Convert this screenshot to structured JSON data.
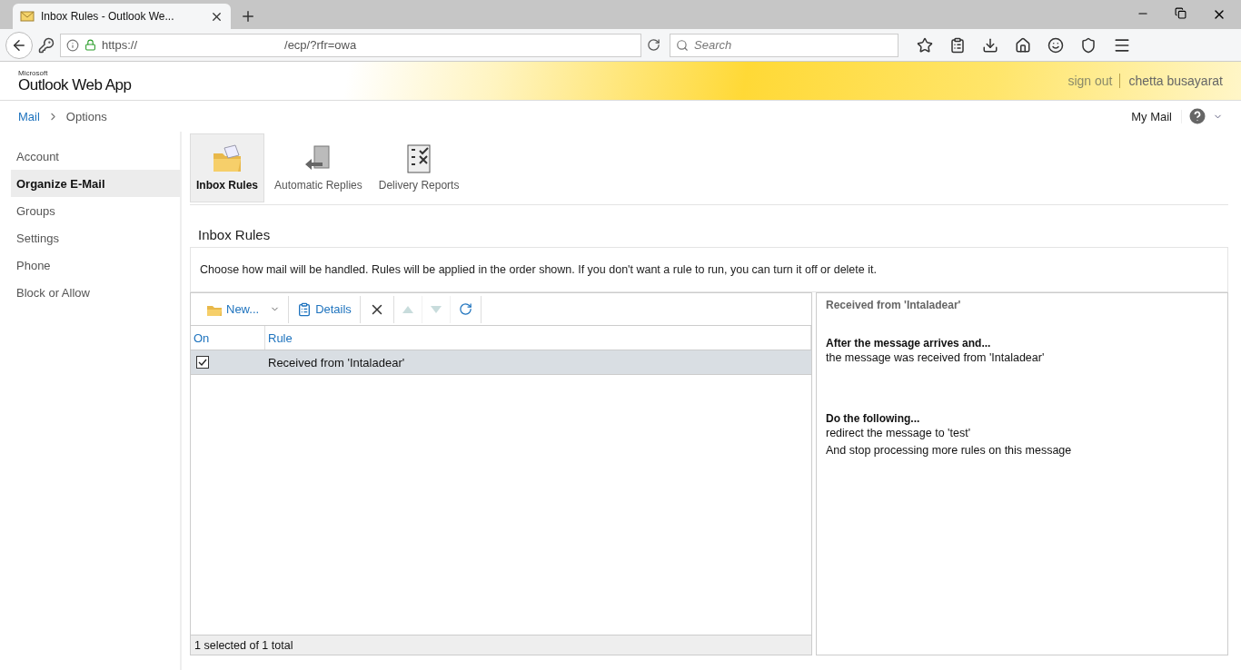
{
  "browser": {
    "tab_title": "Inbox Rules - Outlook We...",
    "url_start": "https://",
    "url_end": "/ecp/?rfr=owa",
    "search_placeholder": "Search"
  },
  "header": {
    "logo_small": "Microsoft",
    "logo": "Outlook Web App",
    "sign_out": "sign out",
    "user": "chetta busayarat"
  },
  "breadcrumb": [
    {
      "label": "Mail",
      "kind": "link"
    },
    {
      "label": "Options",
      "kind": "current"
    }
  ],
  "my_mail": "My Mail",
  "sidebar": {
    "items": [
      {
        "label": "Account",
        "selected": false
      },
      {
        "label": "Organize E-Mail",
        "selected": true
      },
      {
        "label": "Groups",
        "selected": false
      },
      {
        "label": "Settings",
        "selected": false
      },
      {
        "label": "Phone",
        "selected": false
      },
      {
        "label": "Block or Allow",
        "selected": false
      }
    ]
  },
  "tabs": [
    {
      "label": "Inbox Rules",
      "selected": true,
      "kind": "rules"
    },
    {
      "label": "Automatic Replies",
      "selected": false,
      "kind": "replies"
    },
    {
      "label": "Delivery Reports",
      "selected": false,
      "kind": "reports"
    }
  ],
  "section_title": "Inbox Rules",
  "description": "Choose how mail will be handled. Rules will be applied in the order shown. If you don't want a rule to run, you can turn it off or delete it.",
  "toolbar": [
    {
      "kind": "new",
      "label": "New...",
      "disabled": false
    },
    {
      "kind": "details",
      "label": "Details",
      "disabled": false
    },
    {
      "kind": "delete",
      "disabled": false
    },
    {
      "kind": "up",
      "disabled": true
    },
    {
      "kind": "down",
      "disabled": true
    },
    {
      "kind": "refresh",
      "disabled": false
    }
  ],
  "table": {
    "columns": [
      "On",
      "Rule"
    ],
    "rows": [
      {
        "on": true,
        "rule": "Received from 'Intaladear'",
        "selected": true
      }
    ]
  },
  "status": "1 selected of 1 total",
  "details": {
    "title": "Received from 'Intaladear'",
    "sections": [
      {
        "heading": "After the message arrives and...",
        "lines": [
          "the message was received from 'Intaladear'"
        ]
      },
      {
        "heading": "Do the following...",
        "lines": [
          "redirect the message to 'test'",
          "And stop processing more rules on this message"
        ]
      }
    ]
  }
}
